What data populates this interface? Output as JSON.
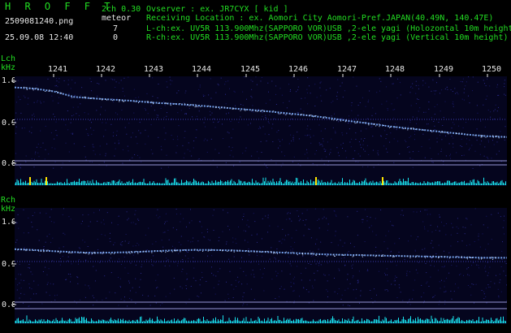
{
  "header": {
    "brand": "H R O F F T",
    "filename": "2509081240.png",
    "datetime": "25.09.08 12:40",
    "channel_label": "2ch 0.30",
    "meteor_label": "meteor",
    "count_l": "7",
    "count_r": "0",
    "observer_line": "Ovserver           : ex. JR7CYX [ kid ]",
    "location_line": "Receiving Location : ex. Aomori City Aomori-Pref.JAPAN(40.49N, 140.47E)",
    "lch_line": "L-ch:ex. UV5R 113.900Mhz(SAPPORO VOR)USB ,2-ele yagi (Holozontal 10m height)",
    "rch_line": "R-ch:ex. UV5R 113.900Mhz(SAPPORO VOR)USB ,2-ele yagi (Vertical 10m height)"
  },
  "time_axis": [
    "1241",
    "1242",
    "1243",
    "1244",
    "1245",
    "1246",
    "1247",
    "1248",
    "1249",
    "1250"
  ],
  "lch": {
    "title": "Lch",
    "unit": "kHz",
    "ticks": [
      "1.0",
      "0.9",
      "0.8"
    ],
    "trace_kHz": [
      0.985,
      0.982,
      0.975,
      0.962,
      0.958,
      0.955,
      0.952,
      0.948,
      0.945,
      0.942,
      0.938,
      0.934,
      0.93,
      0.926,
      0.921,
      0.916,
      0.91,
      0.903,
      0.897,
      0.89,
      0.885,
      0.88,
      0.875,
      0.87,
      0.866,
      0.864
    ]
  },
  "rch": {
    "title": "Rch",
    "unit": "kHz",
    "ticks": [
      "1.0",
      "0.9",
      "0.8"
    ],
    "trace_kHz": [
      0.935,
      0.933,
      0.93,
      0.928,
      0.926,
      0.927,
      0.928,
      0.93,
      0.932,
      0.933,
      0.933,
      0.932,
      0.93,
      0.928,
      0.926,
      0.924,
      0.922,
      0.921,
      0.92,
      0.919,
      0.918,
      0.917,
      0.916,
      0.915,
      0.914,
      0.914
    ]
  },
  "colors": {
    "label_green": "#22dd22",
    "text_white": "#e8e8e8",
    "trace": "#7fb0ff",
    "baseline_cyan": "#19e6f0",
    "meteor_yellow": "#ffe600",
    "noise_blue": "#1a1a70"
  }
}
